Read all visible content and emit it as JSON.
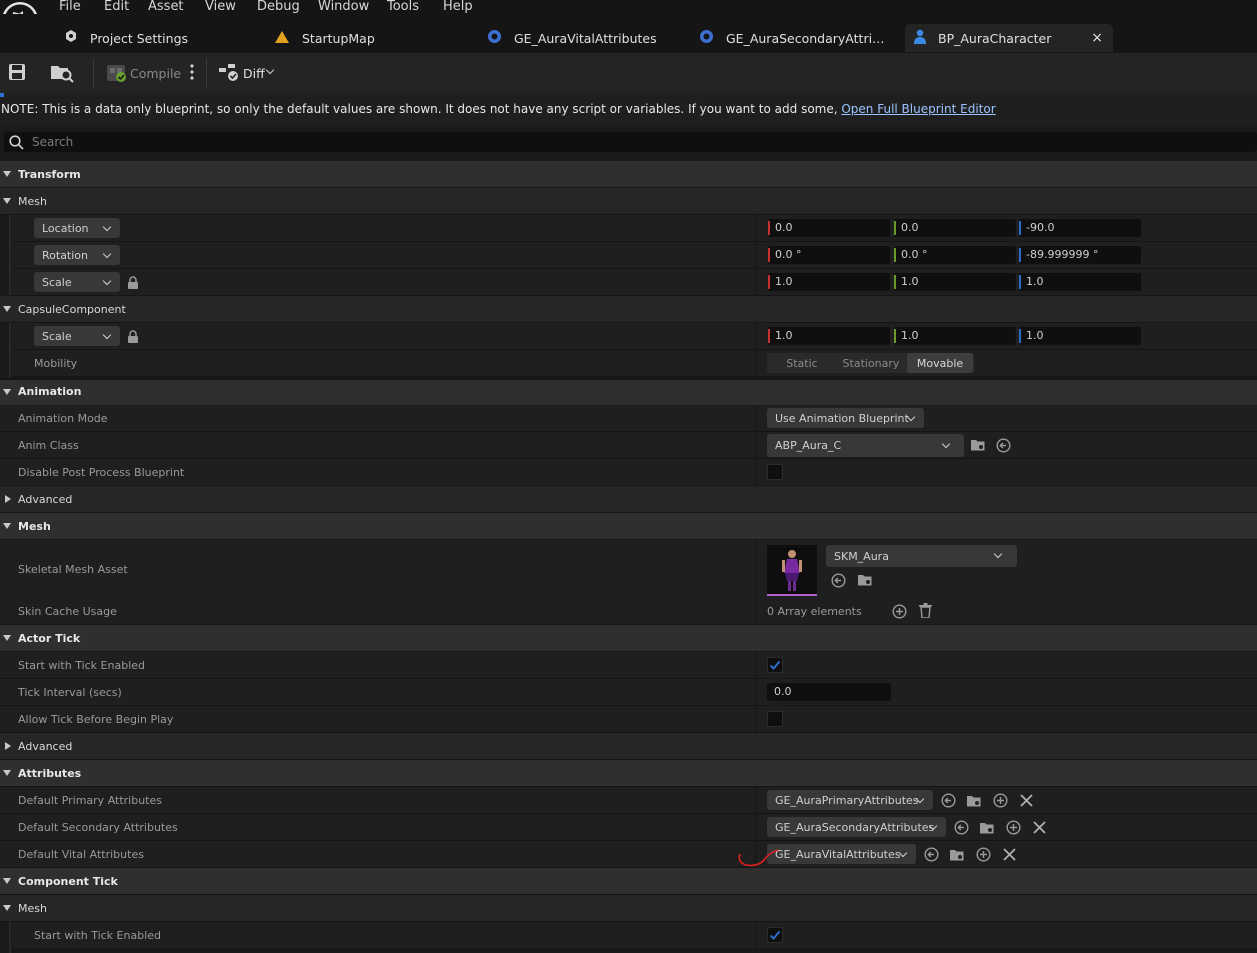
{
  "menu": [
    "File",
    "Edit",
    "Asset",
    "View",
    "Debug",
    "Window",
    "Tools",
    "Help"
  ],
  "tabs": [
    {
      "label": "Project Settings",
      "icon": "settings-gear-icon"
    },
    {
      "label": "StartupMap",
      "icon": "map-icon"
    },
    {
      "label": "GE_AuraVitalAttributes",
      "icon": "blueprint-icon"
    },
    {
      "label": "GE_AuraSecondaryAttri…",
      "icon": "blueprint-icon"
    },
    {
      "label": "BP_AuraCharacter",
      "icon": "character-icon",
      "active": true
    }
  ],
  "toolbar": {
    "compile_label": "Compile",
    "diff_label": "Diff"
  },
  "note": {
    "text": "NOTE: This is a data only blueprint, so only the default values are shown.  It does not have any script or variables.  If you want to add some, ",
    "link": "Open Full Blueprint Editor"
  },
  "search": {
    "placeholder": "Search"
  },
  "details": {
    "transform": "Transform",
    "mesh": "Mesh",
    "location": {
      "label": "Location",
      "x": "0.0",
      "y": "0.0",
      "z": "-90.0"
    },
    "rotation": {
      "label": "Rotation",
      "x": "0.0 °",
      "y": "0.0 °",
      "z": "-89.999999 °"
    },
    "scale": {
      "label": "Scale",
      "x": "1.0",
      "y": "1.0",
      "z": "1.0"
    },
    "capsule": "CapsuleComponent",
    "capsule_scale": {
      "label": "Scale",
      "x": "1.0",
      "y": "1.0",
      "z": "1.0"
    },
    "mobility": {
      "label": "Mobility",
      "options": [
        "Static",
        "Stationary",
        "Movable"
      ],
      "selected": "Movable"
    },
    "animation": "Animation",
    "anim_mode": {
      "label": "Animation Mode",
      "value": "Use Animation Blueprint"
    },
    "anim_class": {
      "label": "Anim Class",
      "value": "ABP_Aura_C"
    },
    "disable_ppb": {
      "label": "Disable Post Process Blueprint"
    },
    "advanced": "Advanced",
    "mesh2": "Mesh",
    "skeletal_mesh": {
      "label": "Skeletal Mesh Asset",
      "value": "SKM_Aura"
    },
    "skin_cache": {
      "label": "Skin Cache Usage",
      "value": "0 Array elements"
    },
    "actor_tick": "Actor Tick",
    "start_tick": {
      "label": "Start with Tick Enabled"
    },
    "tick_interval": {
      "label": "Tick Interval (secs)",
      "value": "0.0"
    },
    "allow_tick": {
      "label": "Allow Tick Before Begin Play"
    },
    "advanced2": "Advanced",
    "attributes": "Attributes",
    "primary": {
      "label": "Default Primary Attributes",
      "value": "GE_AuraPrimaryAttributes"
    },
    "secondary": {
      "label": "Default Secondary Attributes",
      "value": "GE_AuraSecondaryAttributes"
    },
    "vital": {
      "label": "Default Vital Attributes",
      "value": "GE_AuraVitalAttributes"
    },
    "component_tick": "Component Tick",
    "mesh3": "Mesh",
    "start_tick2": {
      "label": "Start with Tick Enabled"
    }
  },
  "colors": {
    "axis_x": "#c8322d",
    "axis_y": "#6b9a2a",
    "axis_z": "#2d6bc8",
    "accent": "#2e73d6",
    "annotation": "#e02020"
  }
}
